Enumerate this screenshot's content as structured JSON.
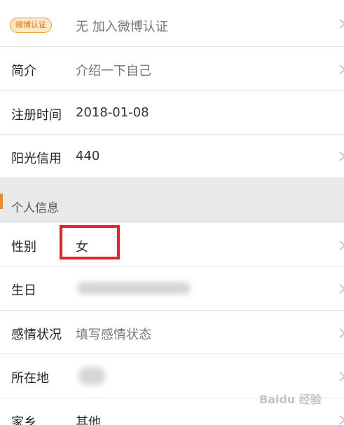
{
  "rows_top": [
    {
      "label": "",
      "value": "无 加入微博认证",
      "badge": "微博认证"
    },
    {
      "label": "简介",
      "value": "介绍一下自己"
    },
    {
      "label": "注册时间",
      "value": "2018-01-08"
    },
    {
      "label": "阳光信用",
      "value": "440"
    }
  ],
  "section": {
    "title": "个人信息"
  },
  "rows_bottom": [
    {
      "label": "性别",
      "value": "女"
    },
    {
      "label": "生日",
      "value": ""
    },
    {
      "label": "感情状况",
      "value": "填写感情状态"
    },
    {
      "label": "所在地",
      "value": ""
    },
    {
      "label": "家乡",
      "value": "其他"
    }
  ],
  "watermark": {
    "text": "Baidu 经验"
  },
  "colors": {
    "accent_orange": "#f08a24",
    "highlight_red": "#e8232e",
    "badge_bg": "#fde7c8",
    "section_bg": "#e9e9e9"
  },
  "icons": {
    "row_arrow": "chevron-right-icon"
  }
}
